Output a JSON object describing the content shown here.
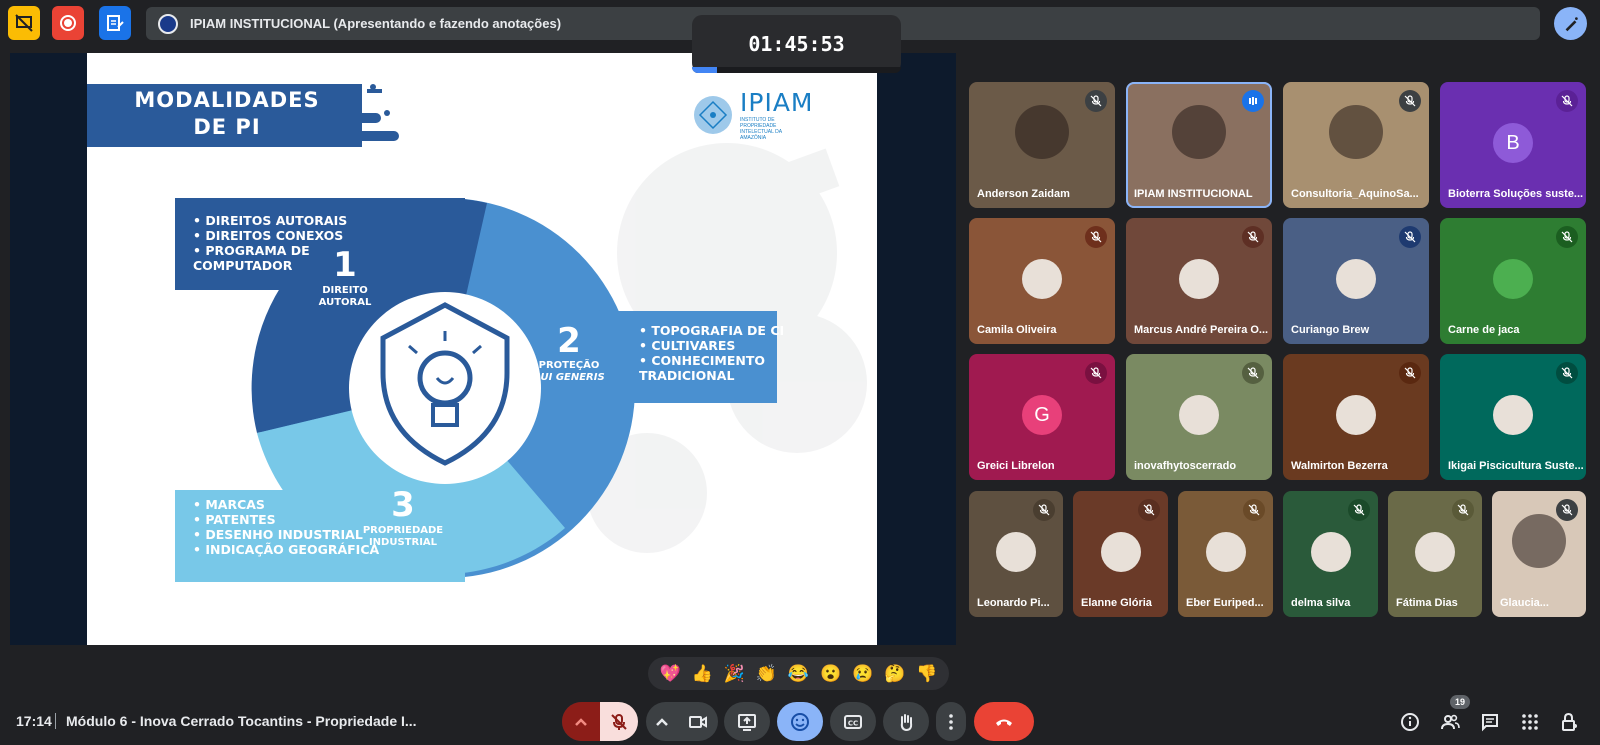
{
  "top_bar": {
    "presentation_title": "IPIAM INSTITUCIONAL (Apresentando e fazendo anotações)",
    "timer": "01:45:53",
    "timer_progress_percent": 12
  },
  "slide": {
    "title_line1": "MODALIDADES",
    "title_line2": "DE PI",
    "logo_name": "IPIAM",
    "logo_subtitle": "INSTITUTO DE PROPRIEDADE INTELECTUAL DA AMAZÔNIA",
    "modalities": [
      {
        "number": "1",
        "label_line1": "DIREITO",
        "label_line2": "AUTORAL",
        "items": [
          "• DIREITOS AUTORAIS",
          "• DIREITOS CONEXOS",
          "• PROGRAMA DE",
          "COMPUTADOR"
        ]
      },
      {
        "number": "2",
        "label_line1": "PROTEÇÃO",
        "label_line2": "SUI GENERIS",
        "items": [
          "• TOPOGRAFIA DE CI",
          "• CULTIVARES",
          "• CONHECIMENTO",
          "TRADICIONAL"
        ]
      },
      {
        "number": "3",
        "label_line1": "PROPRIEDADE",
        "label_line2": "INDUSTRIAL",
        "items": [
          "• MARCAS",
          "• PATENTES",
          "• DESENHO INDUSTRIAL",
          "• INDICAÇÃO GEOGRÁFICA"
        ]
      }
    ]
  },
  "participants": [
    {
      "name": "Anderson Zaidam",
      "initial": "",
      "bg": "#6b5a48"
    },
    {
      "name": "IPIAM INSTITUCIONAL",
      "initial": "",
      "bg": "#8a7060"
    },
    {
      "name": "Consultoria_AquinoSa...",
      "initial": "",
      "bg": "#a89070"
    },
    {
      "name": "Bioterra Soluções suste...",
      "initial": "B",
      "bg": "#6a2fb0"
    },
    {
      "name": "Camila Oliveira",
      "initial": "",
      "bg": "#8a5538"
    },
    {
      "name": "Marcus André Pereira O...",
      "initial": "",
      "bg": "#70483a"
    },
    {
      "name": "Curiango Brew",
      "initial": "",
      "bg": "#4a5f85"
    },
    {
      "name": "Carne de jaca",
      "initial": "",
      "bg": "#2e7d32"
    },
    {
      "name": "Greici Librelon",
      "initial": "G",
      "bg": "#a01a50"
    },
    {
      "name": "inovafhytoscerrado",
      "initial": "",
      "bg": "#7a8a62"
    },
    {
      "name": "Walmirton Bezerra",
      "initial": "",
      "bg": "#6a3a20"
    },
    {
      "name": "Ikigai Piscicultura Suste...",
      "initial": "",
      "bg": "#00695c"
    },
    {
      "name": "Leonardo Pi...",
      "initial": "",
      "bg": "#5e5040"
    },
    {
      "name": "Elanne Glória",
      "initial": "",
      "bg": "#6a3a28"
    },
    {
      "name": "Eber Euriped...",
      "initial": "",
      "bg": "#7a5a38"
    },
    {
      "name": "delma silva",
      "initial": "",
      "bg": "#2a5a3a"
    },
    {
      "name": "Fátima Dias",
      "initial": "",
      "bg": "#6a6a48"
    },
    {
      "name": "Glaucia...",
      "initial": "",
      "bg": "#d8c8b8"
    }
  ],
  "reactions": [
    "💖",
    "👍",
    "🎉",
    "👏",
    "😂",
    "😮",
    "😢",
    "🤔",
    "👎"
  ],
  "bottom_bar": {
    "time": "17:14",
    "meeting_title": "Módulo 6 - Inova Cerrado Tocantins - Propriedade I...",
    "participant_count": "19"
  },
  "colors": {
    "accent": "#8ab4f8",
    "end_call": "#ea4335",
    "mic_off": "#f28b82",
    "slide_dark_blue": "#2a5a9a",
    "slide_mid_blue": "#4a90d0",
    "slide_light_blue": "#78c8e8"
  }
}
